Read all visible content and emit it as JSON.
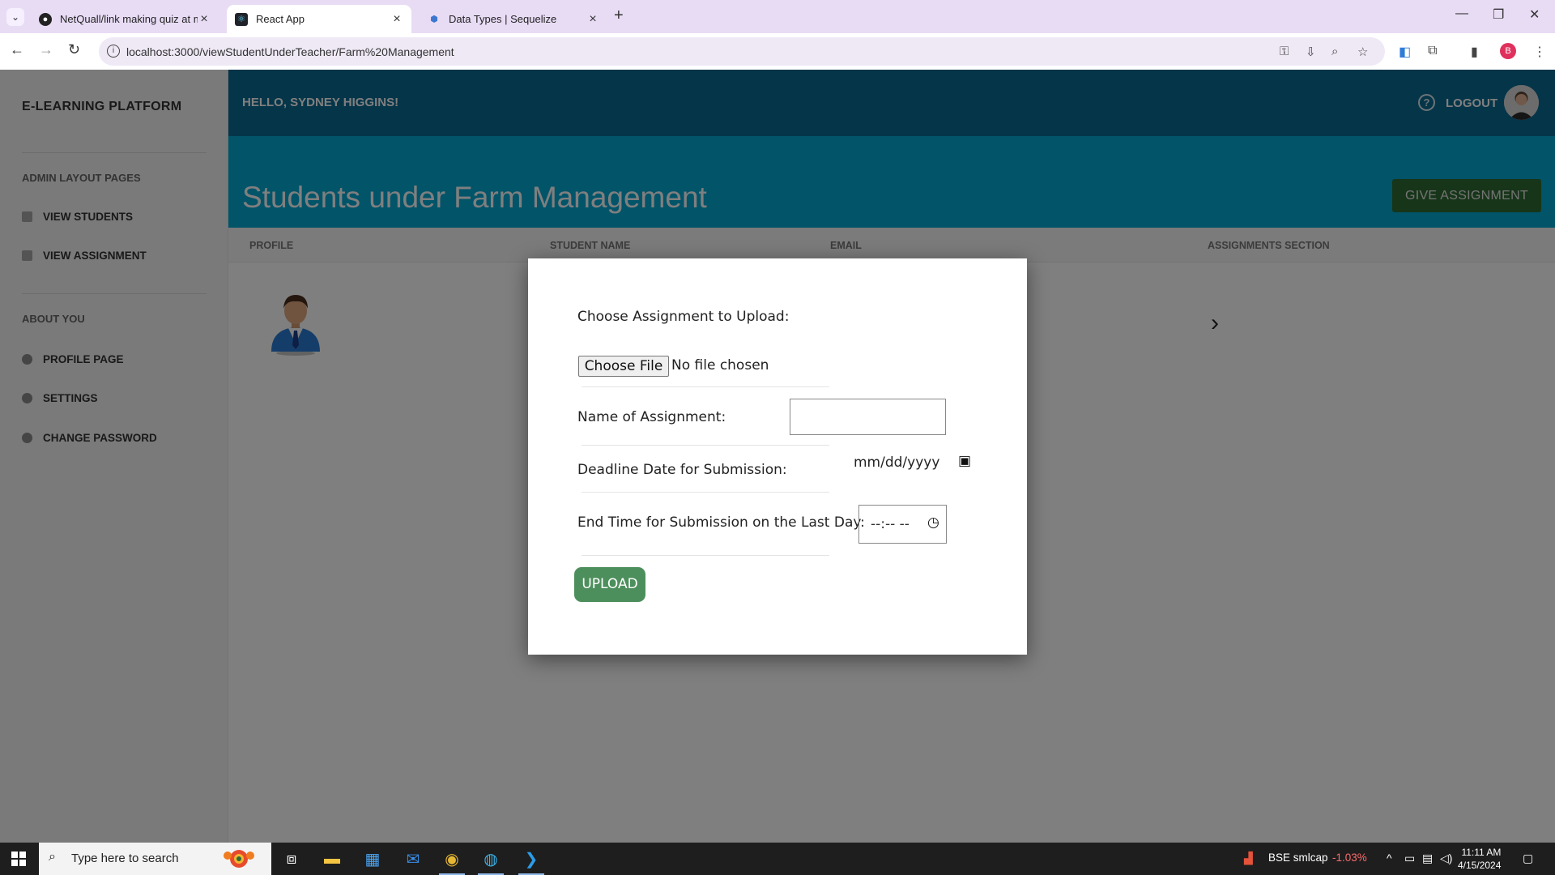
{
  "browser": {
    "tabs": [
      {
        "label": "NetQuall/link making quiz at m",
        "icon": "github-icon"
      },
      {
        "label": "React App",
        "icon": "react-icon"
      },
      {
        "label": "Data Types | Sequelize",
        "icon": "sequelize-icon"
      }
    ],
    "url": "localhost:3000/viewStudentUnderTeacher/Farm%20Management",
    "profile_initial": "B"
  },
  "sidebar": {
    "brand": "E-LEARNING PLATFORM",
    "section1": "ADMIN LAYOUT PAGES",
    "items1": [
      {
        "label": "VIEW STUDENTS"
      },
      {
        "label": "VIEW ASSIGNMENT"
      }
    ],
    "section2": "ABOUT YOU",
    "items2": [
      {
        "label": "PROFILE PAGE"
      },
      {
        "label": "SETTINGS"
      },
      {
        "label": "CHANGE PASSWORD"
      }
    ]
  },
  "header": {
    "greeting": "HELLO, SYDNEY HIGGINS!",
    "logout": "LOGOUT"
  },
  "banner": {
    "title": "Students under Farm Management",
    "button": "GIVE ASSIGNMENT"
  },
  "table": {
    "columns": [
      "PROFILE",
      "STUDENT NAME",
      "EMAIL",
      "ASSIGNMENTS SECTION"
    ]
  },
  "modal": {
    "choose_label": "Choose Assignment to Upload:",
    "file_button": "Choose File",
    "file_status": "No file chosen",
    "name_label": "Name of Assignment:",
    "name_value": "",
    "deadline_label": "Deadline Date for Submission:",
    "date_placeholder": "mm/dd/yyyy",
    "endtime_label": "End Time for Submission on the Last Day:",
    "time_placeholder": "--:-- --",
    "upload_button": "UPLOAD"
  },
  "taskbar": {
    "search_placeholder": "Type here to search",
    "stock_name": "BSE smlcap",
    "stock_change": "-1.03%",
    "time": "11:11 AM",
    "date": "4/15/2024"
  },
  "colors": {
    "topbar": "#0b6a93",
    "banner": "#04a8d3",
    "give_button": "#2f6b33",
    "upload_button": "#4d8f5c"
  }
}
